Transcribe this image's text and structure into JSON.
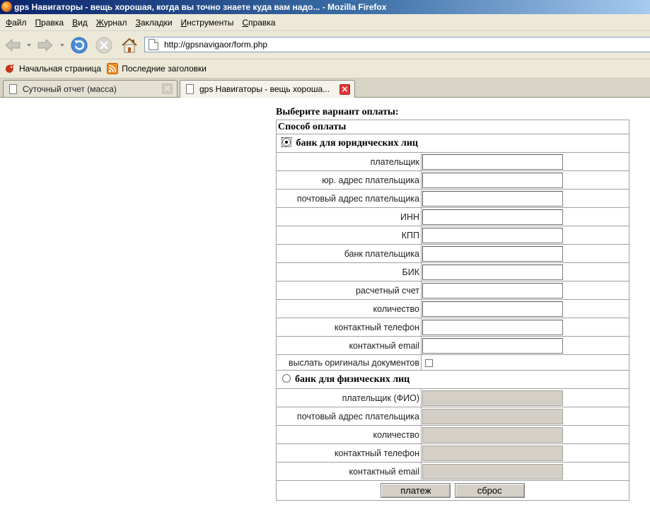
{
  "window": {
    "title": "gps Навигаторы - вещь хорошая, когда вы точно знаете куда вам надо... - Mozilla Firefox"
  },
  "menu": [
    "Файл",
    "Правка",
    "Вид",
    "Журнал",
    "Закладки",
    "Инструменты",
    "Справка"
  ],
  "toolbar": {
    "back_icon": "back-arrow-icon",
    "forward_icon": "forward-arrow-icon",
    "reload_icon": "reload-icon",
    "stop_icon": "stop-icon",
    "home_icon": "home-icon",
    "url": "http://gpsnavigaor/form.php"
  },
  "bookmarks": [
    {
      "label": "Начальная страница",
      "icon": "firefox-bookmark-icon"
    },
    {
      "label": "Последние заголовки",
      "icon": "rss-feed-icon"
    }
  ],
  "tabs": [
    {
      "title": "Суточный отчет (масса)",
      "active": false
    },
    {
      "title": "gps Навигаторы - вещь хороша...",
      "active": true
    }
  ],
  "form": {
    "heading": "Выберите вариант оплаты:",
    "method_header": "Способ оплаты",
    "legal": {
      "label": "банк для юридических лиц",
      "selected": true,
      "fields": [
        {
          "label": "плательщик",
          "value": ""
        },
        {
          "label": "юр. адрес плательщика",
          "value": ""
        },
        {
          "label": "почтовый адрес плательщика",
          "value": ""
        },
        {
          "label": "ИНН",
          "value": ""
        },
        {
          "label": "КПП",
          "value": ""
        },
        {
          "label": "банк плательщика",
          "value": ""
        },
        {
          "label": "БИК",
          "value": ""
        },
        {
          "label": "расчетный счет",
          "value": ""
        },
        {
          "label": "количество",
          "value": ""
        },
        {
          "label": "контактный телефон",
          "value": ""
        },
        {
          "label": "контактный email",
          "value": ""
        }
      ],
      "send_originals_label": "выслать оригиналы документов",
      "send_originals_checked": false
    },
    "individual": {
      "label": "банк для физических лиц",
      "selected": false,
      "fields": [
        {
          "label": "плательщик (ФИО)",
          "value": ""
        },
        {
          "label": "почтовый адрес плательщика",
          "value": ""
        },
        {
          "label": "количество",
          "value": ""
        },
        {
          "label": "контактный телефон",
          "value": ""
        },
        {
          "label": "контактный email",
          "value": ""
        }
      ]
    },
    "submit_label": "платеж",
    "reset_label": "сброс"
  }
}
